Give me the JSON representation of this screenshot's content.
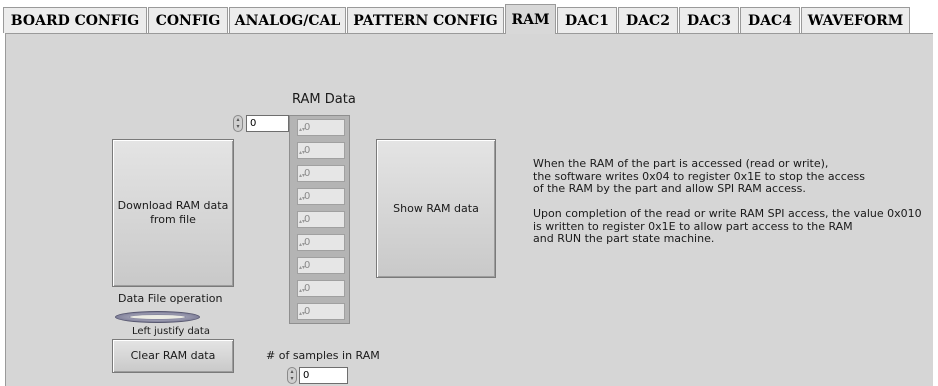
{
  "tabs": [
    {
      "label": "BOARD CONFIG"
    },
    {
      "label": "CONFIG"
    },
    {
      "label": "ANALOG/CAL"
    },
    {
      "label": "PATTERN CONFIG"
    },
    {
      "label": "RAM",
      "active": true
    },
    {
      "label": "DAC1"
    },
    {
      "label": "DAC2"
    },
    {
      "label": "DAC3"
    },
    {
      "label": "DAC4"
    },
    {
      "label": "WAVEFORM"
    }
  ],
  "ram": {
    "download_button": "Download RAM data\nfrom file",
    "data_file_operation_label": "Data File operation",
    "toggle_label": "Left justify data",
    "clear_button": "Clear RAM data",
    "array_title": "RAM Data",
    "array_index": "0",
    "array_values": [
      "0",
      "0",
      "0",
      "0",
      "0",
      "0",
      "0",
      "0",
      "0"
    ],
    "show_button": "Show RAM data",
    "samples_label": "# of samples in RAM",
    "samples_value": "0",
    "info_text": "When the RAM of the part is accessed (read or write),\nthe software writes 0x04 to register 0x1E to stop the access\nof the RAM by the part and allow SPI RAM access.\n\nUpon completion of the read or write RAM SPI access, the value 0x010\nis written to register 0x1E to allow part access to the RAM\nand RUN the part state machine."
  }
}
